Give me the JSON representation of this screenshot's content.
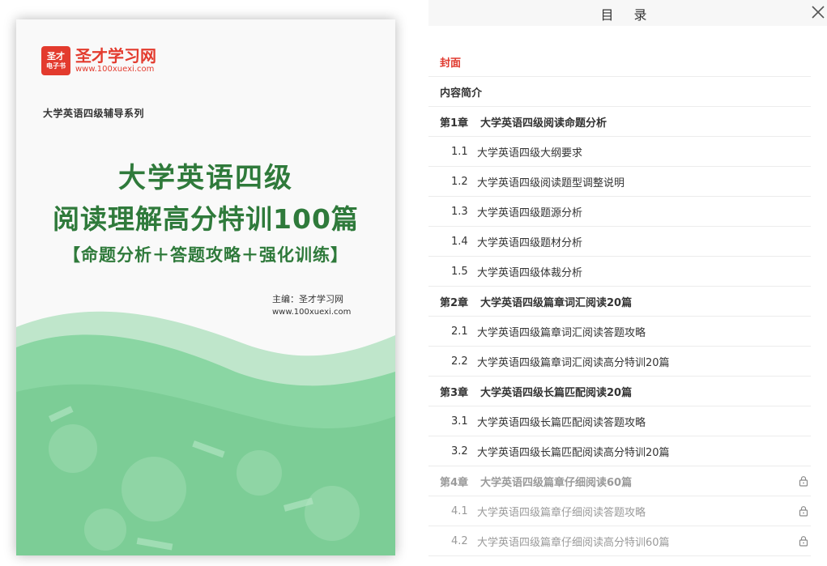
{
  "cover": {
    "logo_badge_top": "圣才",
    "logo_badge_bottom": "电子书",
    "logo_name": "圣才学习网",
    "logo_url": "www.100xuexi.com",
    "series": "大学英语四级辅导系列",
    "title_line1": "大学英语四级",
    "title_line2": "阅读理解高分特训100篇",
    "subtitle": "【命题分析＋答题攻略＋强化训练】",
    "editor": "主编：圣才学习网",
    "editor_url": "www.100xuexi.com",
    "colors": {
      "title": "#2f7a3b",
      "logo": "#e33b2e",
      "wave": "#7fd09a"
    }
  },
  "toc": {
    "title": "目 录",
    "close_icon": "close-icon",
    "items": [
      {
        "type": "chapter",
        "num": "",
        "label": "封面",
        "active": true,
        "locked": false
      },
      {
        "type": "chapter",
        "num": "",
        "label": "内容简介",
        "active": false,
        "locked": false
      },
      {
        "type": "chapter",
        "num": "第1章",
        "label": "大学英语四级阅读命题分析",
        "active": false,
        "locked": false
      },
      {
        "type": "section",
        "num": "1.1",
        "label": "大学英语四级大纲要求",
        "active": false,
        "locked": false
      },
      {
        "type": "section",
        "num": "1.2",
        "label": "大学英语四级阅读题型调整说明",
        "active": false,
        "locked": false
      },
      {
        "type": "section",
        "num": "1.3",
        "label": "大学英语四级题源分析",
        "active": false,
        "locked": false
      },
      {
        "type": "section",
        "num": "1.4",
        "label": "大学英语四级题材分析",
        "active": false,
        "locked": false
      },
      {
        "type": "section",
        "num": "1.5",
        "label": "大学英语四级体裁分析",
        "active": false,
        "locked": false
      },
      {
        "type": "chapter",
        "num": "第2章",
        "label": "大学英语四级篇章词汇阅读20篇",
        "active": false,
        "locked": false
      },
      {
        "type": "section",
        "num": "2.1",
        "label": "大学英语四级篇章词汇阅读答题攻略",
        "active": false,
        "locked": false
      },
      {
        "type": "section",
        "num": "2.2",
        "label": "大学英语四级篇章词汇阅读高分特训20篇",
        "active": false,
        "locked": false
      },
      {
        "type": "chapter",
        "num": "第3章",
        "label": "大学英语四级长篇匹配阅读20篇",
        "active": false,
        "locked": false
      },
      {
        "type": "section",
        "num": "3.1",
        "label": "大学英语四级长篇匹配阅读答题攻略",
        "active": false,
        "locked": false
      },
      {
        "type": "section",
        "num": "3.2",
        "label": "大学英语四级长篇匹配阅读高分特训20篇",
        "active": false,
        "locked": false
      },
      {
        "type": "chapter",
        "num": "第4章",
        "label": "大学英语四级篇章仔细阅读60篇",
        "active": false,
        "locked": true
      },
      {
        "type": "section",
        "num": "4.1",
        "label": "大学英语四级篇章仔细阅读答题攻略",
        "active": false,
        "locked": true
      },
      {
        "type": "section",
        "num": "4.2",
        "label": "大学英语四级篇章仔细阅读高分特训60篇",
        "active": false,
        "locked": true
      }
    ]
  }
}
